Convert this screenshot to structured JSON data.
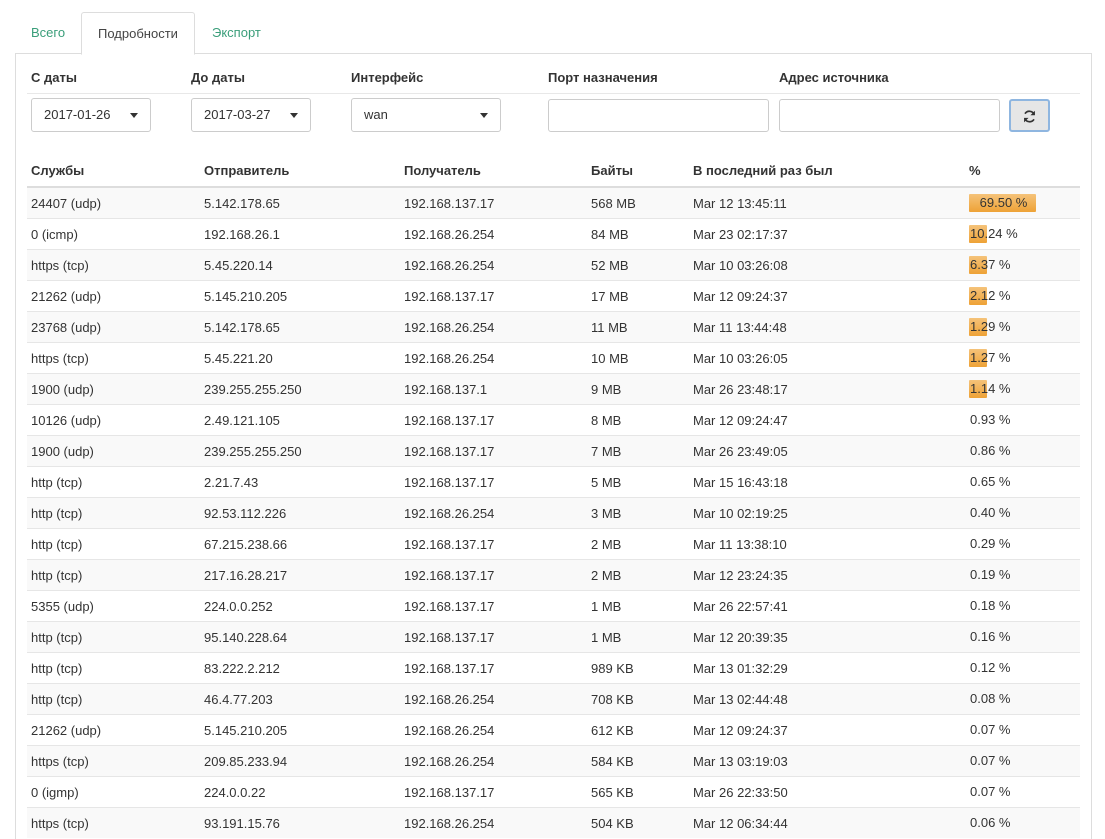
{
  "tabs": [
    {
      "label": "Всего",
      "active": false
    },
    {
      "label": "Подробности",
      "active": true
    },
    {
      "label": "Экспорт",
      "active": false
    }
  ],
  "filters": {
    "from_label": "С даты",
    "from_value": "2017-01-26",
    "to_label": "До даты",
    "to_value": "2017-03-27",
    "iface_label": "Интерфейс",
    "iface_value": "wan",
    "port_label": "Порт назначения",
    "port_value": "",
    "src_label": "Адрес источника",
    "src_value": ""
  },
  "table": {
    "headers": [
      "Службы",
      "Отправитель",
      "Получатель",
      "Байты",
      "В последний раз был",
      "%"
    ],
    "rows": [
      {
        "service": "24407 (udp)",
        "sender": "5.142.178.65",
        "receiver": "192.168.137.17",
        "bytes": "568 MB",
        "last_seen": "Mar 12 13:45:11",
        "pct": "69.50 %",
        "pct_value": 69.5
      },
      {
        "service": "0 (icmp)",
        "sender": "192.168.26.1",
        "receiver": "192.168.26.254",
        "bytes": "84 MB",
        "last_seen": "Mar 23 02:17:37",
        "pct": "10.24 %",
        "pct_value": 10.24
      },
      {
        "service": "https (tcp)",
        "sender": "5.45.220.14",
        "receiver": "192.168.26.254",
        "bytes": "52 MB",
        "last_seen": "Mar 10 03:26:08",
        "pct": "6.37 %",
        "pct_value": 6.37
      },
      {
        "service": "21262 (udp)",
        "sender": "5.145.210.205",
        "receiver": "192.168.137.17",
        "bytes": "17 MB",
        "last_seen": "Mar 12 09:24:37",
        "pct": "2.12 %",
        "pct_value": 2.12
      },
      {
        "service": "23768 (udp)",
        "sender": "5.142.178.65",
        "receiver": "192.168.26.254",
        "bytes": "11 MB",
        "last_seen": "Mar 11 13:44:48",
        "pct": "1.29 %",
        "pct_value": 1.29
      },
      {
        "service": "https (tcp)",
        "sender": "5.45.221.20",
        "receiver": "192.168.26.254",
        "bytes": "10 MB",
        "last_seen": "Mar 10 03:26:05",
        "pct": "1.27 %",
        "pct_value": 1.27
      },
      {
        "service": "1900 (udp)",
        "sender": "239.255.255.250",
        "receiver": "192.168.137.1",
        "bytes": "9 MB",
        "last_seen": "Mar 26 23:48:17",
        "pct": "1.14 %",
        "pct_value": 1.14
      },
      {
        "service": "10126 (udp)",
        "sender": "2.49.121.105",
        "receiver": "192.168.137.17",
        "bytes": "8 MB",
        "last_seen": "Mar 12 09:24:47",
        "pct": "0.93 %",
        "pct_value": 0.93
      },
      {
        "service": "1900 (udp)",
        "sender": "239.255.255.250",
        "receiver": "192.168.137.17",
        "bytes": "7 MB",
        "last_seen": "Mar 26 23:49:05",
        "pct": "0.86 %",
        "pct_value": 0.86
      },
      {
        "service": "http (tcp)",
        "sender": "2.21.7.43",
        "receiver": "192.168.137.17",
        "bytes": "5 MB",
        "last_seen": "Mar 15 16:43:18",
        "pct": "0.65 %",
        "pct_value": 0.65
      },
      {
        "service": "http (tcp)",
        "sender": "92.53.112.226",
        "receiver": "192.168.26.254",
        "bytes": "3 MB",
        "last_seen": "Mar 10 02:19:25",
        "pct": "0.40 %",
        "pct_value": 0.4
      },
      {
        "service": "http (tcp)",
        "sender": "67.215.238.66",
        "receiver": "192.168.137.17",
        "bytes": "2 MB",
        "last_seen": "Mar 11 13:38:10",
        "pct": "0.29 %",
        "pct_value": 0.29
      },
      {
        "service": "http (tcp)",
        "sender": "217.16.28.217",
        "receiver": "192.168.137.17",
        "bytes": "2 MB",
        "last_seen": "Mar 12 23:24:35",
        "pct": "0.19 %",
        "pct_value": 0.19
      },
      {
        "service": "5355 (udp)",
        "sender": "224.0.0.252",
        "receiver": "192.168.137.17",
        "bytes": "1 MB",
        "last_seen": "Mar 26 22:57:41",
        "pct": "0.18 %",
        "pct_value": 0.18
      },
      {
        "service": "http (tcp)",
        "sender": "95.140.228.64",
        "receiver": "192.168.137.17",
        "bytes": "1 MB",
        "last_seen": "Mar 12 20:39:35",
        "pct": "0.16 %",
        "pct_value": 0.16
      },
      {
        "service": "http (tcp)",
        "sender": "83.222.2.212",
        "receiver": "192.168.137.17",
        "bytes": "989 KB",
        "last_seen": "Mar 13 01:32:29",
        "pct": "0.12 %",
        "pct_value": 0.12
      },
      {
        "service": "http (tcp)",
        "sender": "46.4.77.203",
        "receiver": "192.168.26.254",
        "bytes": "708 KB",
        "last_seen": "Mar 13 02:44:48",
        "pct": "0.08 %",
        "pct_value": 0.08
      },
      {
        "service": "21262 (udp)",
        "sender": "5.145.210.205",
        "receiver": "192.168.26.254",
        "bytes": "612 KB",
        "last_seen": "Mar 12 09:24:37",
        "pct": "0.07 %",
        "pct_value": 0.07
      },
      {
        "service": "https (tcp)",
        "sender": "209.85.233.94",
        "receiver": "192.168.26.254",
        "bytes": "584 KB",
        "last_seen": "Mar 13 03:19:03",
        "pct": "0.07 %",
        "pct_value": 0.07
      },
      {
        "service": "0 (igmp)",
        "sender": "224.0.0.22",
        "receiver": "192.168.137.17",
        "bytes": "565 KB",
        "last_seen": "Mar 26 22:33:50",
        "pct": "0.07 %",
        "pct_value": 0.07
      },
      {
        "service": "https (tcp)",
        "sender": "93.191.15.76",
        "receiver": "192.168.26.254",
        "bytes": "504 KB",
        "last_seen": "Mar 12 06:34:44",
        "pct": "0.06 %",
        "pct_value": 0.06
      }
    ]
  },
  "colors": {
    "accent": "#3a9e7a",
    "bar": "#f0ad4e"
  },
  "icons": {
    "refresh": "refresh-icon",
    "caret": "chevron-down-icon"
  }
}
